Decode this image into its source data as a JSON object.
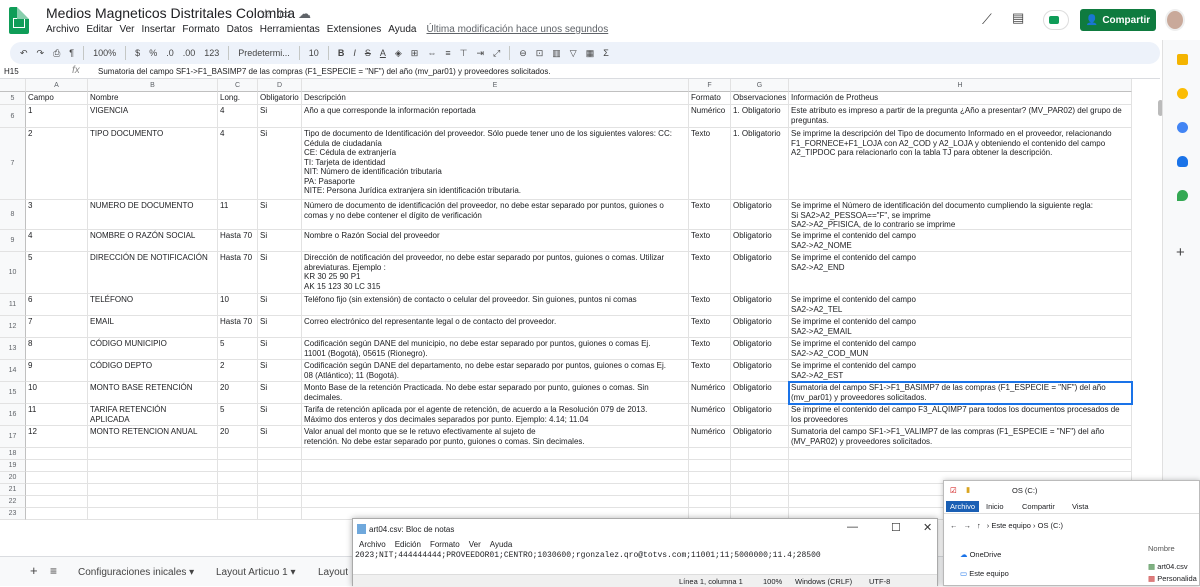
{
  "app": {
    "title": "Medios Magneticos Distritales Colombia",
    "menu": [
      "Archivo",
      "Editar",
      "Ver",
      "Insertar",
      "Formato",
      "Datos",
      "Herramientas",
      "Extensiones",
      "Ayuda"
    ],
    "last_edit": "Última modificación hace unos segundos",
    "share_label": "Compartir"
  },
  "toolbar": {
    "zoom": "100%",
    "currency": "$",
    "percent": "%",
    "dec1": ".0",
    "dec2": ".00",
    "num_format": "123",
    "font": "Predetermi...",
    "size": "10"
  },
  "formula": {
    "cellref": "H15",
    "fx": "fx",
    "text": "Sumatoria del campo SF1->F1_BASIMP7 de las compras (F1_ESPECIE = \"NF\") del año (mv_par01) y proveedores solicitados."
  },
  "columns": [
    "A",
    "B",
    "C",
    "D",
    "E",
    "F",
    "G",
    "H"
  ],
  "rows": [
    {
      "n": "5",
      "cells": [
        "Campo",
        "Nombre",
        "Long.",
        "Obligatorio",
        "Descripción",
        "Formato",
        "Observaciones",
        "Información de Protheus"
      ]
    },
    {
      "n": "6",
      "cells": [
        "1",
        "VIGENCIA",
        "4",
        "Si",
        "Año a que corresponde la información reportada",
        "Numérico",
        "1. Obligatorio",
        "Este atributo es impreso a partir de la pregunta ¿Año a presentar? (MV_PAR02) del grupo de preguntas."
      ]
    },
    {
      "n": "7",
      "cells": [
        "2",
        "TIPO DOCUMENTO",
        "4",
        "Si",
        "Tipo de documento de Identificación del proveedor. Sólo puede tener uno de los siguientes valores: CC: Cédula de ciudadanía\nCE: Cédula de extranjería\n TI: Tarjeta de identidad\nNIT: Número de identificación tributaria\nPA: Pasaporte\nNITE: Persona Jurídica extranjera sin identificación tributaria.",
        "Texto",
        "1. Obligatorio",
        "Se imprime la descripción del Tipo de documento Informado en el proveedor, relacionando F1_FORNECE+F1_LOJA con A2_COD y A2_LOJA y obteniendo el contenido del campo A2_TIPDOC para relacionarlo con la tabla TJ para obtener la descripción."
      ]
    },
    {
      "n": "8",
      "cells": [
        "3",
        "NUMERO DE DOCUMENTO",
        "11",
        "Si",
        "Número de documento de identificación del proveedor, no debe estar separado por puntos, guiones o comas y no debe contener el dígito de verificación",
        "Texto",
        "Obligatorio",
        "Se imprime el Número de identificación del documento cumpliendo la siguiente regla:\nSi SA2>A2_PESSOA==\"F\", se imprime\nSA2->A2_PFISICA, de lo contrario se imprime\nSA2->A2_CGC"
      ]
    },
    {
      "n": "9",
      "cells": [
        "4",
        "NOMBRE O RAZÓN SOCIAL",
        "Hasta 70",
        "Si",
        "Nombre o Razón Social del proveedor",
        "Texto",
        "Obligatorio",
        "Se imprime el contenido del campo\nSA2->A2_NOME"
      ]
    },
    {
      "n": "10",
      "cells": [
        "5",
        "DIRECCIÓN DE NOTIFICACIÓN",
        "Hasta 70",
        "Si",
        "Dirección de notificación del proveedor, no debe estar separado por puntos, guiones o comas. Utilizar abreviaturas. Ejemplo :\nKR 30 25 90 P1\nAK 15 123 30 LC 315",
        "Texto",
        "Obligatorio",
        "Se imprime el contenido del campo\nSA2->A2_END"
      ]
    },
    {
      "n": "11",
      "cells": [
        "6",
        "TELÉFONO",
        "10",
        "Si",
        "Teléfono fijo (sin extensión) de contacto o celular del proveedor. Sin guiones, puntos ni comas",
        "Texto",
        "Obligatorio",
        "Se imprime el contenido del campo\nSA2->A2_TEL"
      ]
    },
    {
      "n": "12",
      "cells": [
        "7",
        "EMAIL",
        "Hasta 70",
        "Si",
        "Correo electrónico del representante legal o de contacto del proveedor.",
        "Texto",
        "Obligatorio",
        "Se imprime el contenido del campo\nSA2->A2_EMAIL"
      ]
    },
    {
      "n": "13",
      "cells": [
        "8",
        "CÓDIGO MUNICIPIO",
        "5",
        "Si",
        "Codificación según DANE del municipio, no debe estar separado por puntos, guiones o comas Ej.\n11001 (Bogotá), 05615 (Rionegro).",
        "Texto",
        "Obligatorio",
        "Se imprime el contenido del campo\nSA2->A2_COD_MUN"
      ]
    },
    {
      "n": "14",
      "cells": [
        "9",
        "CÓDIGO DEPTO",
        "2",
        "Si",
        "Codificación según DANE del departamento, no debe estar separado por puntos, guiones o comas Ej.\n08 (Atlántico); 11 (Bogotá).",
        "Texto",
        "Obligatorio",
        "Se imprime el contenido del campo\nSA2->A2_EST"
      ]
    },
    {
      "n": "15",
      "cells": [
        "10",
        "MONTO BASE RETENCIÓN",
        "20",
        "Si",
        "Monto Base de la retención Practicada. No debe estar separado por punto, guiones o comas. Sin decimales.",
        "Numérico",
        "Obligatorio",
        "Sumatoria del campo SF1->F1_BASIMP7 de las compras (F1_ESPECIE = \"NF\") del año (mv_par01) y proveedores solicitados."
      ]
    },
    {
      "n": "16",
      "cells": [
        "11",
        "TARIFA RETENCIÓN\nAPLICADA",
        "5",
        "Si",
        "Tarifa de retención aplicada por el agente de retención, de acuerdo a la Resolución 079 de 2013.\nMáximo dos enteros y dos decimales separados por punto. Ejemplo: 4.14; 11.04",
        "Numérico",
        "Obligatorio",
        "Se imprime el contenido del campo F3_ALQIMP7 para todos los documentos procesados de los proveedores"
      ]
    },
    {
      "n": "17",
      "cells": [
        "12",
        "MONTO RETENCION ANUAL",
        "20",
        "Si",
        "Valor anual del monto que se le retuvo efectivamente al sujeto de\nretención. No debe estar separado por punto, guiones o comas. Sin decimales.",
        "Numérico",
        "Obligatorio",
        "Sumatoria del campo SF1->F1_VALIMP7 de las compras (F1_ESPECIE = \"NF\") del año (MV_PAR02) y proveedores solicitados."
      ]
    },
    {
      "n": "18",
      "cells": [
        "",
        "",
        "",
        "",
        "",
        "",
        "",
        ""
      ]
    },
    {
      "n": "19",
      "cells": [
        "",
        "",
        "",
        "",
        "",
        "",
        "",
        ""
      ]
    },
    {
      "n": "20",
      "cells": [
        "",
        "",
        "",
        "",
        "",
        "",
        "",
        ""
      ]
    },
    {
      "n": "21",
      "cells": [
        "",
        "",
        "",
        "",
        "",
        "",
        "",
        ""
      ]
    },
    {
      "n": "22",
      "cells": [
        "",
        "",
        "",
        "",
        "",
        "",
        "",
        ""
      ]
    },
    {
      "n": "23",
      "cells": [
        "",
        "",
        "",
        "",
        "",
        "",
        "",
        ""
      ]
    }
  ],
  "sheets": {
    "add": "+",
    "list": "≡",
    "tab1": "Configuraciones inicales",
    "tab2": "Layout Articuo 1",
    "tab3": "Layout"
  },
  "notepad": {
    "title": "art04.csv: Bloc de notas",
    "menu": [
      "Archivo",
      "Edición",
      "Formato",
      "Ver",
      "Ayuda"
    ],
    "content": "2023;NIT;444444444;PROVEEDOR01;CENTRO;1030600;rgonzalez.qro@totvs.com;11001;11;5000000;11.4;28500",
    "status": [
      "Línea 1, columna 1",
      "100%",
      "Windows (CRLF)",
      "UTF-8"
    ]
  },
  "explorer": {
    "title": "OS (C:)",
    "ribbon": [
      "Archivo",
      "Inicio",
      "Compartir",
      "Vista"
    ],
    "path": [
      "Este equipo",
      "OS (C:)"
    ],
    "nav": [
      "OneDrive",
      "Este equipo"
    ],
    "col_header": "Nombre",
    "files": [
      "art04.csv",
      "Personalida"
    ]
  },
  "colors": {
    "accent": "#1a73e8",
    "share": "#0f7b3f"
  }
}
